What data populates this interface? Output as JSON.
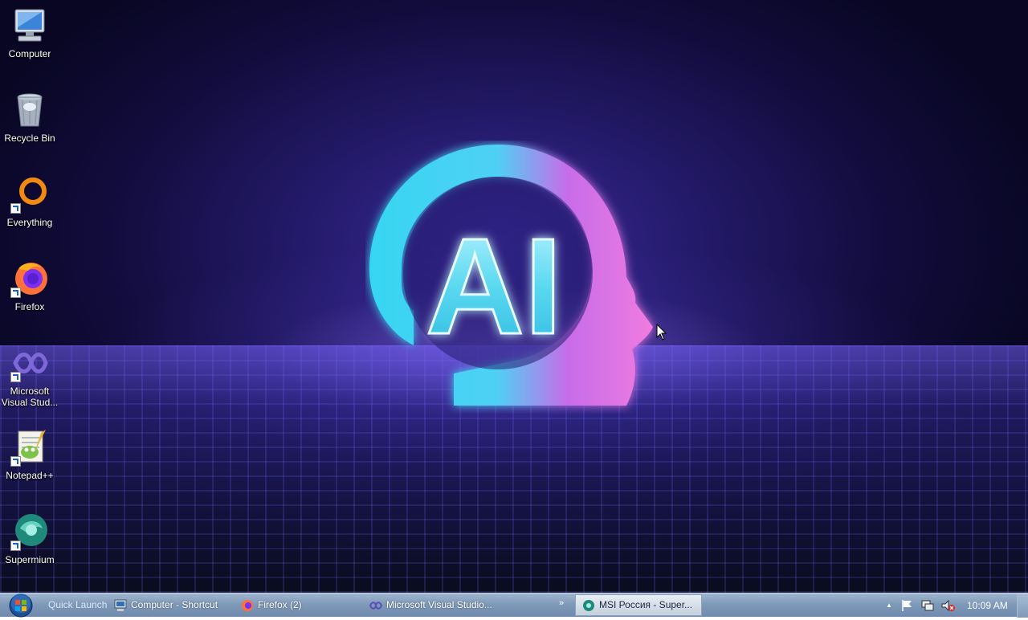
{
  "desktop": {
    "wallpaper_text": "AI",
    "icons": [
      {
        "label": "Computer",
        "icon": "computer-icon"
      },
      {
        "label": "Recycle Bin",
        "icon": "recycle-bin-icon"
      },
      {
        "label": "Everything",
        "icon": "everything-icon"
      },
      {
        "label": "Firefox",
        "icon": "firefox-icon"
      },
      {
        "label": "Microsoft\nVisual Stud...",
        "icon": "visual-studio-icon"
      },
      {
        "label": "Notepad++",
        "icon": "notepadpp-icon"
      },
      {
        "label": "Supermium",
        "icon": "supermium-icon"
      }
    ]
  },
  "taskbar": {
    "quick_launch": "Quick Launch",
    "overflow": "»",
    "tasks": [
      {
        "label": "Computer - Shortcut",
        "icon": "computer-icon"
      },
      {
        "label": "Firefox (2)",
        "icon": "firefox-icon"
      },
      {
        "label": "Microsoft Visual Studio...",
        "icon": "visual-studio-icon"
      },
      {
        "label": "MSI Россия - Super...",
        "icon": "supermium-icon",
        "active": true
      }
    ],
    "tray": {
      "icons": [
        "chevron-up-icon",
        "flag-icon",
        "network-icon",
        "volume-muted-icon"
      ],
      "up_arrow": "▲",
      "clock": "10:09 AM"
    }
  },
  "colors": {
    "taskbar": "#7f9ab9",
    "accent_cyan": "#37e0f0",
    "accent_magenta": "#e660e6"
  }
}
